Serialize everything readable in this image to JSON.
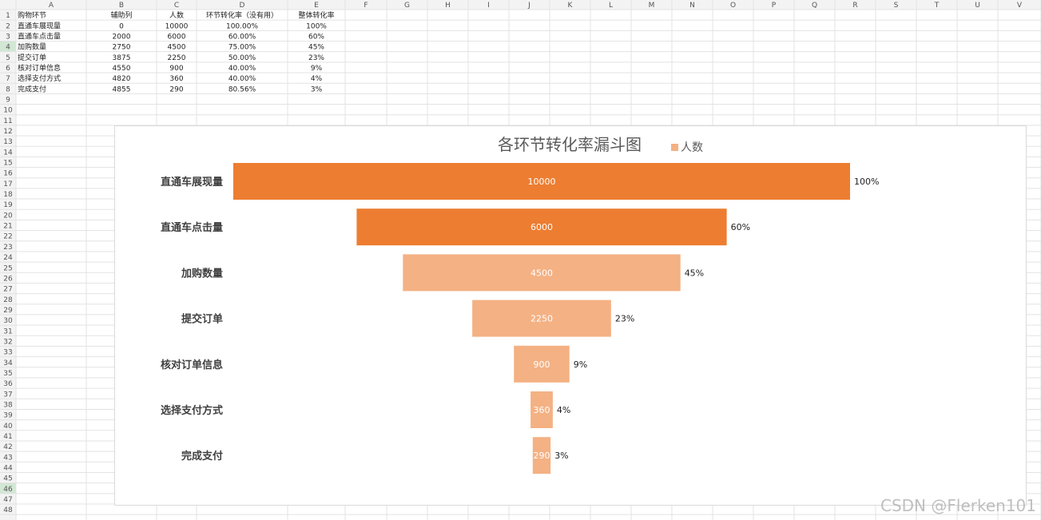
{
  "sheet": {
    "col_headers": [
      "A",
      "B",
      "C",
      "D",
      "E",
      "F",
      "G",
      "H",
      "I",
      "J",
      "K",
      "L",
      "M",
      "N",
      "O",
      "P",
      "Q",
      "R",
      "S",
      "T",
      "U",
      "V"
    ],
    "row_count": 48,
    "active_row": 4,
    "active_row2": 46,
    "table_header": [
      "购物环节",
      "辅助列",
      "人数",
      "环节转化率（没有用）",
      "整体转化率"
    ],
    "table_rows": [
      [
        "直通车展现量",
        "0",
        "10000",
        "100.00%",
        "100%"
      ],
      [
        "直通车点击量",
        "2000",
        "6000",
        "60.00%",
        "60%"
      ],
      [
        "加购数量",
        "2750",
        "4500",
        "75.00%",
        "45%"
      ],
      [
        "提交订单",
        "3875",
        "2250",
        "50.00%",
        "23%"
      ],
      [
        "核对订单信息",
        "4550",
        "900",
        "40.00%",
        "9%"
      ],
      [
        "选择支付方式",
        "4820",
        "360",
        "40.00%",
        "4%"
      ],
      [
        "完成支付",
        "4855",
        "290",
        "80.56%",
        "3%"
      ]
    ]
  },
  "chart_data": {
    "type": "bar",
    "orientation": "horizontal-stacked-funnel",
    "title": "各环节转化率漏斗图",
    "categories": [
      "直通车展现量",
      "直通车点击量",
      "加购数量",
      "提交订单",
      "核对订单信息",
      "选择支付方式",
      "完成支付"
    ],
    "helper_series": {
      "values": [
        0,
        2000,
        2750,
        3875,
        4550,
        4820,
        4855
      ],
      "visible": false
    },
    "series": [
      {
        "name": "人数",
        "values": [
          10000,
          6000,
          4500,
          2250,
          900,
          360,
          290
        ]
      }
    ],
    "percent_labels": [
      "100%",
      "60%",
      "45%",
      "23%",
      "9%",
      "4%",
      "3%"
    ],
    "xlim": [
      0,
      10000
    ],
    "colors": {
      "dark": "#ED7D31",
      "light": "#F4B183"
    },
    "dark_bar_count": 2,
    "legend_position": "top"
  },
  "watermark": "CSDN @Flerken101"
}
